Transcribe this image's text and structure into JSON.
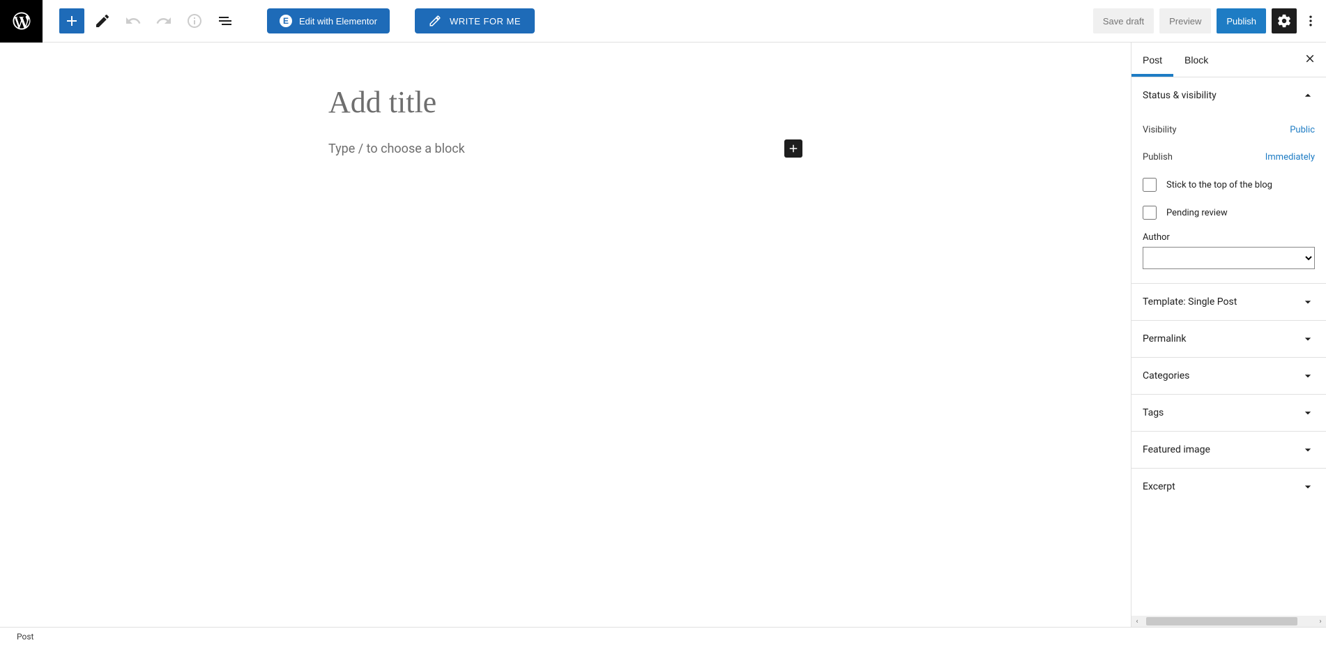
{
  "toolbar": {
    "elementor_label": "Edit with Elementor",
    "write_label": "WRITE FOR ME",
    "save_draft": "Save draft",
    "preview": "Preview",
    "publish": "Publish"
  },
  "canvas": {
    "title_placeholder": "Add title",
    "block_prompt": "Type / to choose a block"
  },
  "sidebar": {
    "tabs": {
      "post": "Post",
      "block": "Block"
    },
    "panels": {
      "status": {
        "title": "Status & visibility",
        "visibility_label": "Visibility",
        "visibility_value": "Public",
        "publish_label": "Publish",
        "publish_value": "Immediately",
        "stick_label": "Stick to the top of the blog",
        "pending_label": "Pending review",
        "author_label": "Author",
        "author_value": ""
      },
      "template": "Template: Single Post",
      "permalink": "Permalink",
      "categories": "Categories",
      "tags": "Tags",
      "featured": "Featured image",
      "excerpt": "Excerpt"
    }
  },
  "footer": {
    "breadcrumb": "Post"
  }
}
